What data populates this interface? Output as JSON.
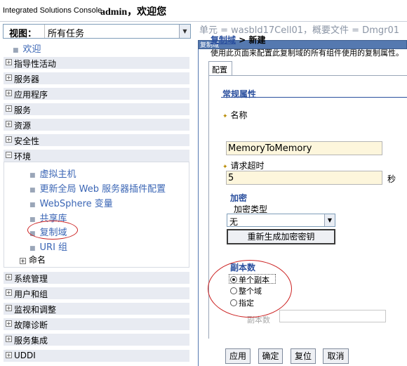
{
  "header": {
    "brand": "Integrated Solutions Console",
    "welcome": "admin，欢迎您"
  },
  "nav": {
    "view_label": "视图：",
    "view_value": "所有任务",
    "welcome_link": "欢迎",
    "groups_top": [
      {
        "icon": "plus",
        "label": "指导性活动"
      },
      {
        "icon": "plus",
        "label": "服务器"
      },
      {
        "icon": "plus",
        "label": "应用程序"
      },
      {
        "icon": "plus",
        "label": "服务"
      },
      {
        "icon": "plus",
        "label": "资源"
      },
      {
        "icon": "plus",
        "label": "安全性"
      },
      {
        "icon": "minus",
        "label": "环境"
      }
    ],
    "env_items": [
      "虚拟主机",
      "更新全局 Web 服务器插件配置",
      "WebSphere 变量",
      "共享库",
      "复制域",
      "URI 组"
    ],
    "naming": "命名",
    "groups_bottom": [
      {
        "icon": "plus",
        "label": "系统管理"
      },
      {
        "icon": "plus",
        "label": "用户和组"
      },
      {
        "icon": "plus",
        "label": "监视和调整"
      },
      {
        "icon": "plus",
        "label": "故障诊断"
      },
      {
        "icon": "plus",
        "label": "服务集成"
      },
      {
        "icon": "plus",
        "label": "UDDI"
      }
    ]
  },
  "main": {
    "scope": "单元 = wasbld17Cell01，概要文件 = Dmgr01",
    "portlet_title": "复制域",
    "breadcrumb_link": "复制域",
    "breadcrumb_sep": " > ",
    "breadcrumb_current": "新建",
    "description": "使用此页面来配置此复制域的所有组件使用的复制属性。",
    "tab": "配置",
    "general_title": "常规属性",
    "name_label": "名称",
    "name_value": "MemoryToMemory",
    "timeout_label": "请求超时",
    "timeout_value": "5",
    "timeout_unit": "秒",
    "encryption_title": "加密",
    "encryption_type_label": "加密类型",
    "encryption_type_value": "无",
    "regen_button": "重新生成加密密钥",
    "replicas_title": "副本数",
    "radio_single": "单个副本",
    "radio_entire": "整个域",
    "radio_specify": "指定",
    "replicas_field_label": "副本数",
    "buttons": {
      "apply": "应用",
      "ok": "确定",
      "reset": "复位",
      "cancel": "取消"
    }
  },
  "colors": {
    "accent": "#2a4f9e",
    "link": "#3b66b5",
    "nav_group_bg": "#e8ebf2",
    "annotation": "#cc2222"
  }
}
